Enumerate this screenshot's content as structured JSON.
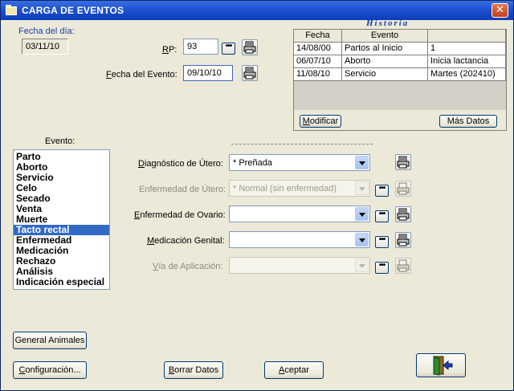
{
  "window": {
    "title": "CARGA DE EVENTOS",
    "close_glyph": "✕"
  },
  "fecha_dia": {
    "label": "Fecha del día:",
    "value": "03/11/10"
  },
  "rp": {
    "label_pre": "",
    "label_u": "R",
    "label_post": "P:",
    "value": "93",
    "dots": "•••"
  },
  "fecha_evento": {
    "label_u": "F",
    "label_post": "echa del Evento:",
    "value": "09/10/10"
  },
  "historia": {
    "title": "Historia",
    "columns": [
      "Fecha",
      "Evento",
      ""
    ],
    "rows": [
      [
        "14/08/00",
        "Partos al Inicio",
        "1"
      ],
      [
        "06/07/10",
        "Aborto",
        "Inicia lactancia"
      ],
      [
        "11/08/10",
        "Servicio",
        "Martes (202410)"
      ]
    ],
    "modificar_u": "M",
    "modificar_post": "odificar",
    "mas_datos": "Más Datos"
  },
  "evento": {
    "label": "Evento:",
    "items": [
      "Parto",
      "Aborto",
      "Servicio",
      "Celo",
      "Secado",
      "Venta",
      "Muerte",
      "Tacto rectal",
      "Enfermedad",
      "Medicación",
      "Rechazo",
      "Análisis",
      "Indicación especial"
    ],
    "selected": "Tacto rectal"
  },
  "fields": {
    "diagnostico": {
      "label_pre": "",
      "label_u": "D",
      "label_post": "iagnóstico de Útero:",
      "value": "* Preñada"
    },
    "enf_utero": {
      "label": "Enfermedad de Útero:",
      "value": "* Normal (sin enfermedad)"
    },
    "enf_ovario": {
      "label_u": "E",
      "label_post": "nfermedad de Ovario:",
      "value": ""
    },
    "medicacion": {
      "label_u": "M",
      "label_post": "edicación Genital:",
      "value": ""
    },
    "via": {
      "label_u": "V",
      "label_post": "ía de Aplicación:",
      "value": ""
    }
  },
  "buttons": {
    "general_animales": "General Animales",
    "configuracion_u": "C",
    "configuracion_post": "onfiguración...",
    "borrar_datos_u": "B",
    "borrar_datos_post": "orrar Datos",
    "aceptar_u": "A",
    "aceptar_post": "ceptar"
  },
  "icons": {
    "printer": "printer-icon",
    "exit": "exit-door-icon"
  }
}
